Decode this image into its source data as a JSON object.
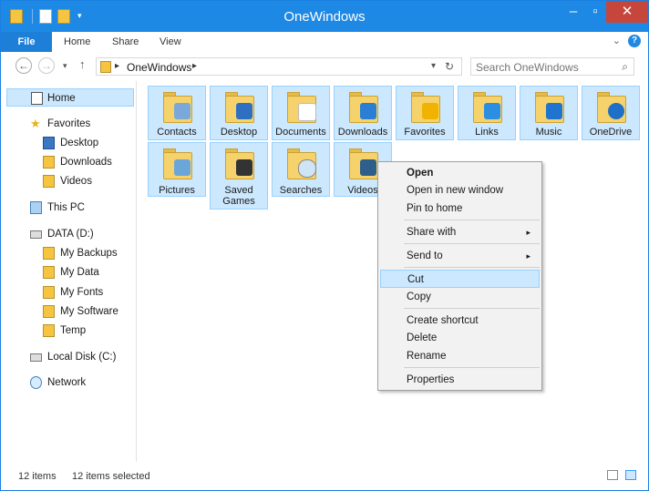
{
  "window": {
    "title": "OneWindows",
    "close_label": "✕"
  },
  "ribbon": {
    "tabs": [
      "File",
      "Home",
      "Share",
      "View"
    ],
    "help": "?"
  },
  "navigation": {
    "address_path": "OneWindows",
    "search_placeholder": "Search OneWindows"
  },
  "sidebar": {
    "items": [
      {
        "label": "Home",
        "icon": "home-icon"
      },
      {
        "label": "Favorites",
        "icon": "star-icon"
      },
      {
        "label": "Desktop",
        "icon": "desktop-icon"
      },
      {
        "label": "Downloads",
        "icon": "folder-icon"
      },
      {
        "label": "Videos",
        "icon": "folder-icon"
      },
      {
        "label": "This PC",
        "icon": "pc-icon"
      },
      {
        "label": "DATA (D:)",
        "icon": "drive-icon"
      },
      {
        "label": "My Backups",
        "icon": "folder-icon"
      },
      {
        "label": "My Data",
        "icon": "folder-icon"
      },
      {
        "label": "My Fonts",
        "icon": "folder-icon"
      },
      {
        "label": "My Software",
        "icon": "folder-icon"
      },
      {
        "label": "Temp",
        "icon": "folder-icon"
      },
      {
        "label": "Local Disk (C:)",
        "icon": "drive-icon"
      },
      {
        "label": "Network",
        "icon": "network-icon"
      }
    ]
  },
  "folders": [
    {
      "label": "Contacts",
      "icon": "contacts-folder-icon",
      "badge": "#7aa8d8"
    },
    {
      "label": "Desktop",
      "icon": "desktop-folder-icon",
      "badge": "#2f6fc2"
    },
    {
      "label": "Documents",
      "icon": "documents-folder-icon",
      "badge": "#ffffff"
    },
    {
      "label": "Downloads",
      "icon": "downloads-folder-icon",
      "badge": "#2a7fd4"
    },
    {
      "label": "Favorites",
      "icon": "favorites-folder-icon",
      "badge": "#f0b400"
    },
    {
      "label": "Links",
      "icon": "links-folder-icon",
      "badge": "#2a8fe0"
    },
    {
      "label": "Music",
      "icon": "music-folder-icon",
      "badge": "#1f74d0"
    },
    {
      "label": "OneDrive",
      "icon": "onedrive-folder-icon",
      "badge": "#1e6fc8"
    },
    {
      "label": "Pictures",
      "icon": "pictures-folder-icon",
      "badge": "#6aa7d8"
    },
    {
      "label": "Saved Games",
      "icon": "saved-games-folder-icon",
      "badge": "#333333"
    },
    {
      "label": "Searches",
      "icon": "searches-folder-icon",
      "badge": "#cfe4f5"
    },
    {
      "label": "Videos",
      "icon": "videos-folder-icon",
      "badge": "#2d5f8a"
    }
  ],
  "context_menu": {
    "items": [
      "Open",
      "Open in new window",
      "Pin to home",
      "Share with",
      "Send to",
      "Cut",
      "Copy",
      "Create shortcut",
      "Delete",
      "Rename",
      "Properties"
    ],
    "submenu_arrow": "▸"
  },
  "status": {
    "item_count": "12 items",
    "selected_count": "12 items selected"
  }
}
